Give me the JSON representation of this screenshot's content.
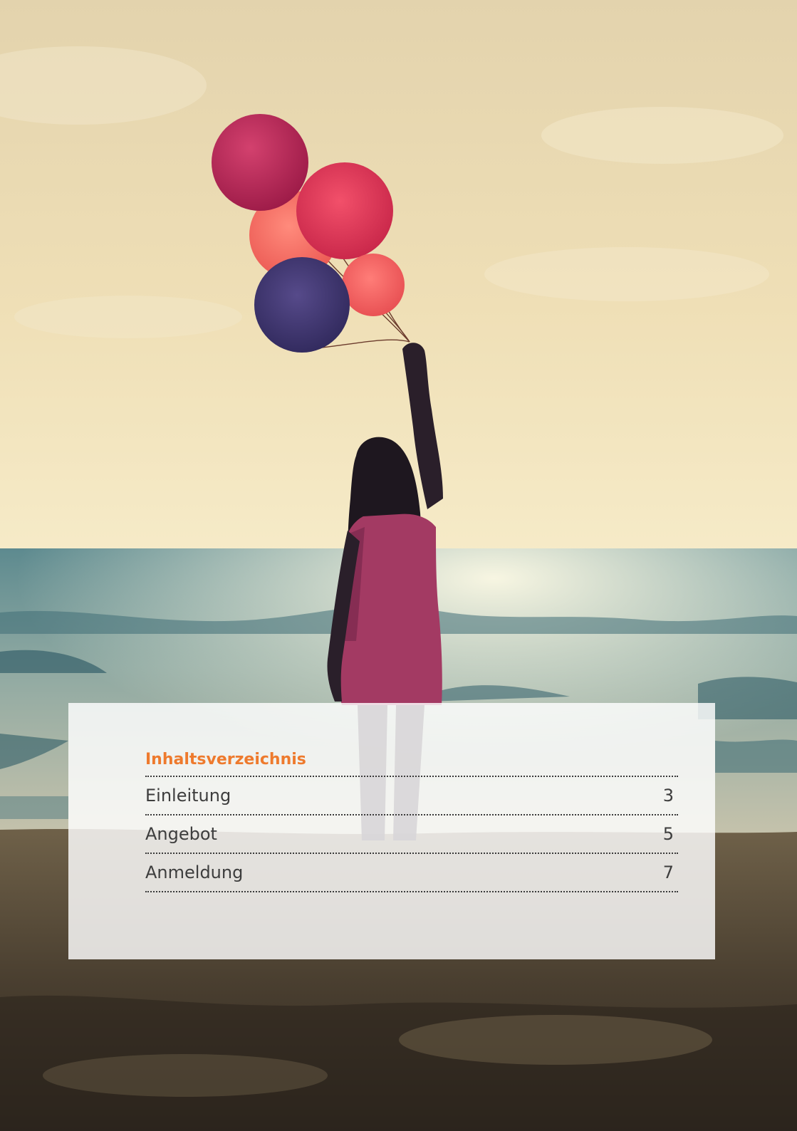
{
  "toc": {
    "heading": "Inhaltsverzeichnis",
    "items": [
      {
        "label": "Einleitung",
        "page": "3"
      },
      {
        "label": "Angebot",
        "page": "5"
      },
      {
        "label": "Anmeldung",
        "page": "7"
      }
    ]
  },
  "colors": {
    "accent": "#ee7a2d",
    "text": "#3d3d3d"
  }
}
